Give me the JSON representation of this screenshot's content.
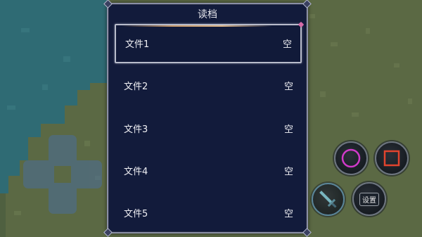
{
  "dialog": {
    "title": "读档",
    "slots": [
      {
        "name": "文件1",
        "status": "空",
        "selected": true
      },
      {
        "name": "文件2",
        "status": "空",
        "selected": false
      },
      {
        "name": "文件3",
        "status": "空",
        "selected": false
      },
      {
        "name": "文件4",
        "status": "空",
        "selected": false
      },
      {
        "name": "文件5",
        "status": "空",
        "selected": false
      }
    ]
  },
  "controls": {
    "dpad_icon": "dpad-icon",
    "circle_icon": "circle-icon",
    "square_icon": "square-icon",
    "sword_icon": "sword-icon",
    "settings_label": "设置"
  },
  "colors": {
    "dialog_bg": "#121b3b",
    "water": "#2e6b75",
    "grass": "#5c6a45",
    "circle_accent": "#d13ac9",
    "square_accent": "#e0442e"
  }
}
